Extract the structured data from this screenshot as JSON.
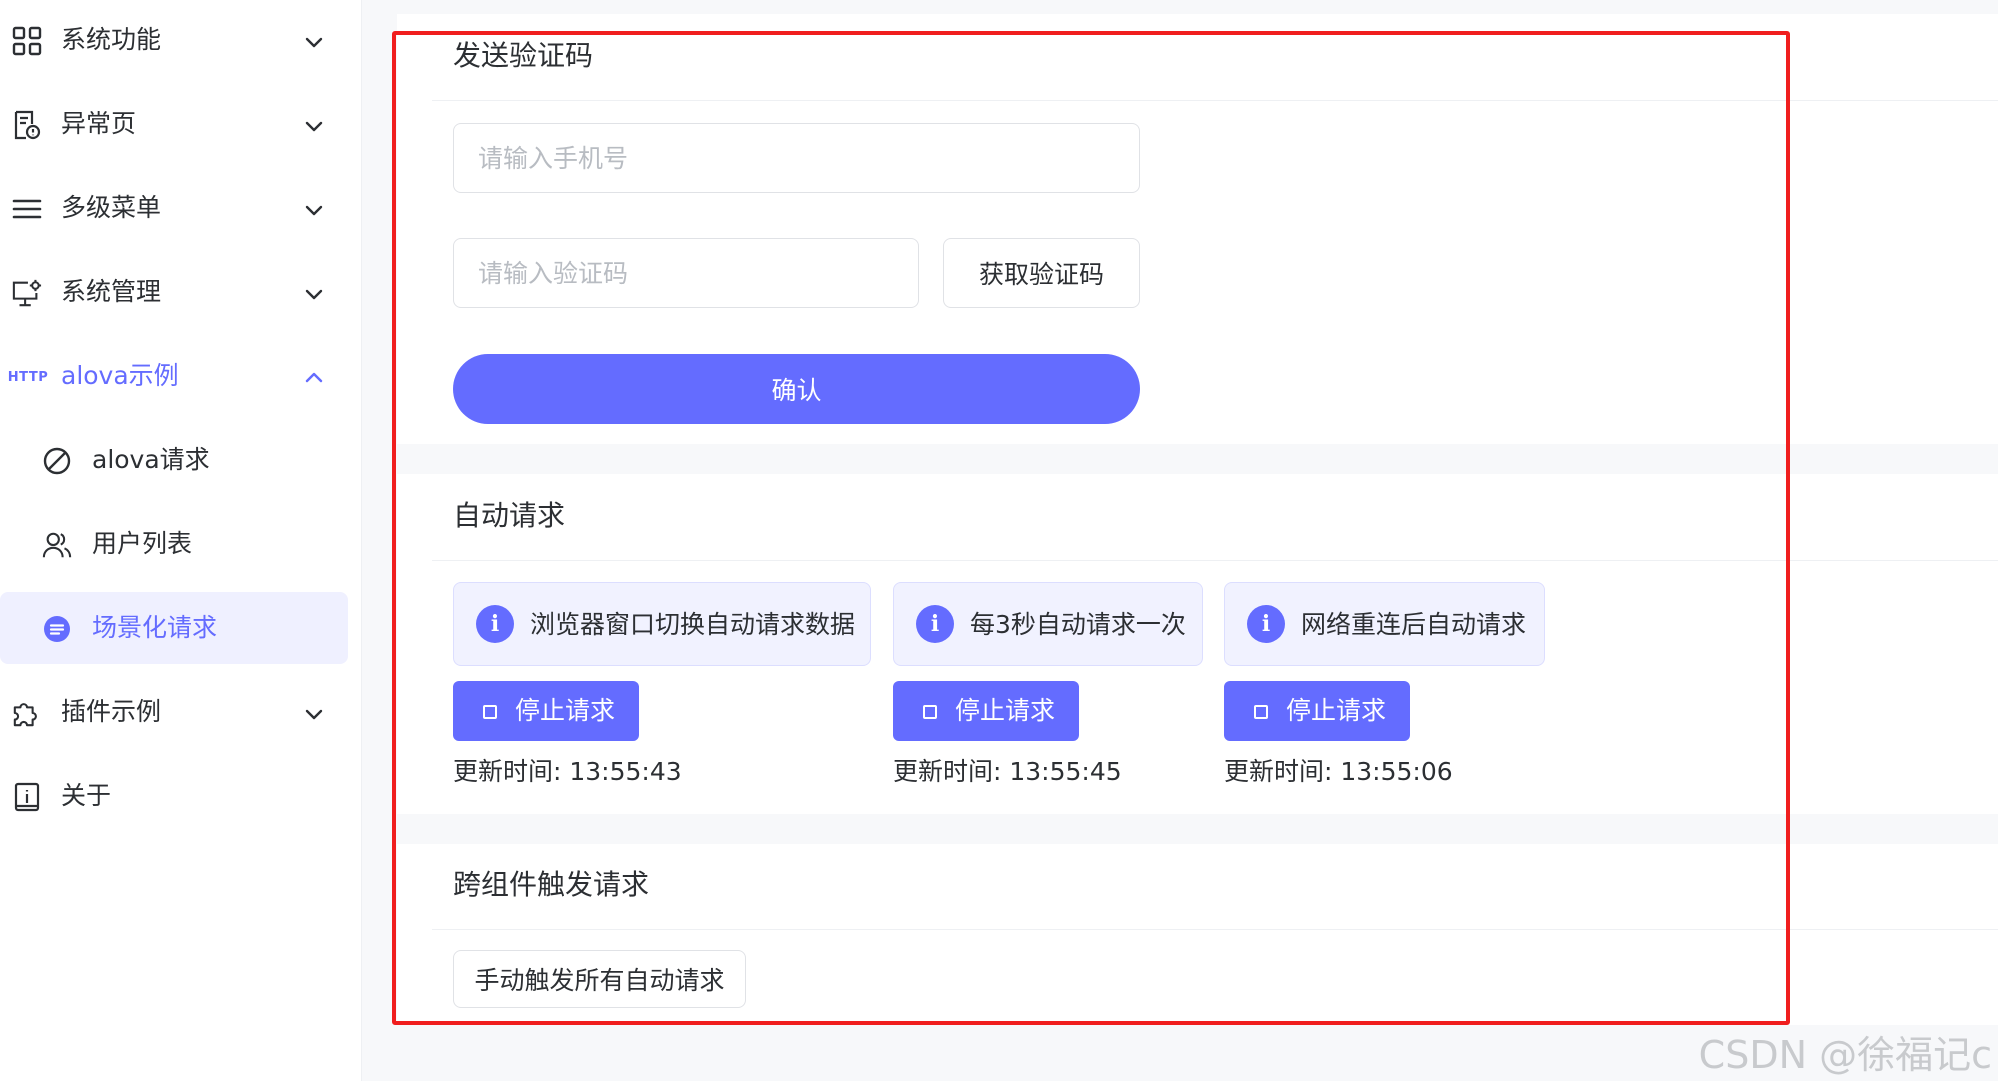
{
  "sidebar": {
    "items": [
      {
        "label": "系统功能",
        "icon": "grid-icon"
      },
      {
        "label": "异常页",
        "icon": "error-page-icon"
      },
      {
        "label": "多级菜单",
        "icon": "menu-lines-icon"
      },
      {
        "label": "系统管理",
        "icon": "monitor-gear-icon"
      },
      {
        "label": "alova示例",
        "icon": "http-icon",
        "icon_text": "HTTP",
        "expanded": true
      },
      {
        "label": "alova请求",
        "icon": "forbidden-circle-icon"
      },
      {
        "label": "用户列表",
        "icon": "users-icon"
      },
      {
        "label": "场景化请求",
        "icon": "list-circle-icon",
        "active": true
      },
      {
        "label": "插件示例",
        "icon": "puzzle-icon"
      },
      {
        "label": "关于",
        "icon": "info-book-icon"
      }
    ]
  },
  "verify_card": {
    "title": "发送验证码",
    "phone_placeholder": "请输入手机号",
    "code_placeholder": "请输入验证码",
    "get_code_label": "获取验证码",
    "confirm_label": "确认"
  },
  "auto_card": {
    "title": "自动请求",
    "groups": [
      {
        "alert": "浏览器窗口切换自动请求数据",
        "stop_label": "停止请求",
        "time": "更新时间: 13:55:43"
      },
      {
        "alert": "每3秒自动请求一次",
        "stop_label": "停止请求",
        "time": "更新时间: 13:55:45"
      },
      {
        "alert": "网络重连后自动请求",
        "stop_label": "停止请求",
        "time": "更新时间: 13:55:06"
      }
    ]
  },
  "cross_card": {
    "title": "跨组件触发请求",
    "trigger_label": "手动触发所有自动请求"
  },
  "watermark": "CSDN @徐福记c",
  "colors": {
    "accent": "#646cff",
    "highlight_frame": "#f01e1e",
    "active_bg": "#eff0ff"
  }
}
